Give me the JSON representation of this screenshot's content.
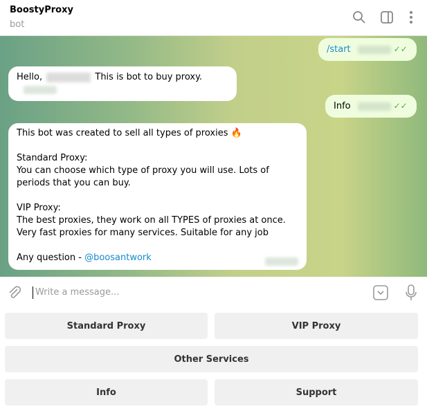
{
  "header": {
    "title": "BoostyProxy",
    "subtitle": "bot"
  },
  "messages": [
    {
      "dir": "out",
      "text": "/start"
    },
    {
      "dir": "in",
      "prefix": "Hello,",
      "suffix": "This is bot to buy proxy."
    },
    {
      "dir": "out",
      "text": "Info"
    },
    {
      "dir": "in",
      "lines": [
        "This bot was created to sell all types of proxies 🔥",
        "Standard Proxy:",
        "You can choose which type of proxy you will use. Lots of periods that you can buy.",
        "VIP Proxy:",
        "The best proxies, they work on all TYPES of proxies at once. Very fast proxies for many services. Suitable for any job"
      ],
      "last_prefix": "Any question - ",
      "last_link": "@boosantwork"
    }
  ],
  "input": {
    "placeholder": "Write a message..."
  },
  "keyboard": {
    "standard": "Standard Proxy",
    "vip": "VIP Proxy",
    "other": "Other Services",
    "info": "Info",
    "support": "Support"
  },
  "colors": {
    "link": "#168acd",
    "outgoing": "#effdde",
    "check": "#4fae4e"
  }
}
